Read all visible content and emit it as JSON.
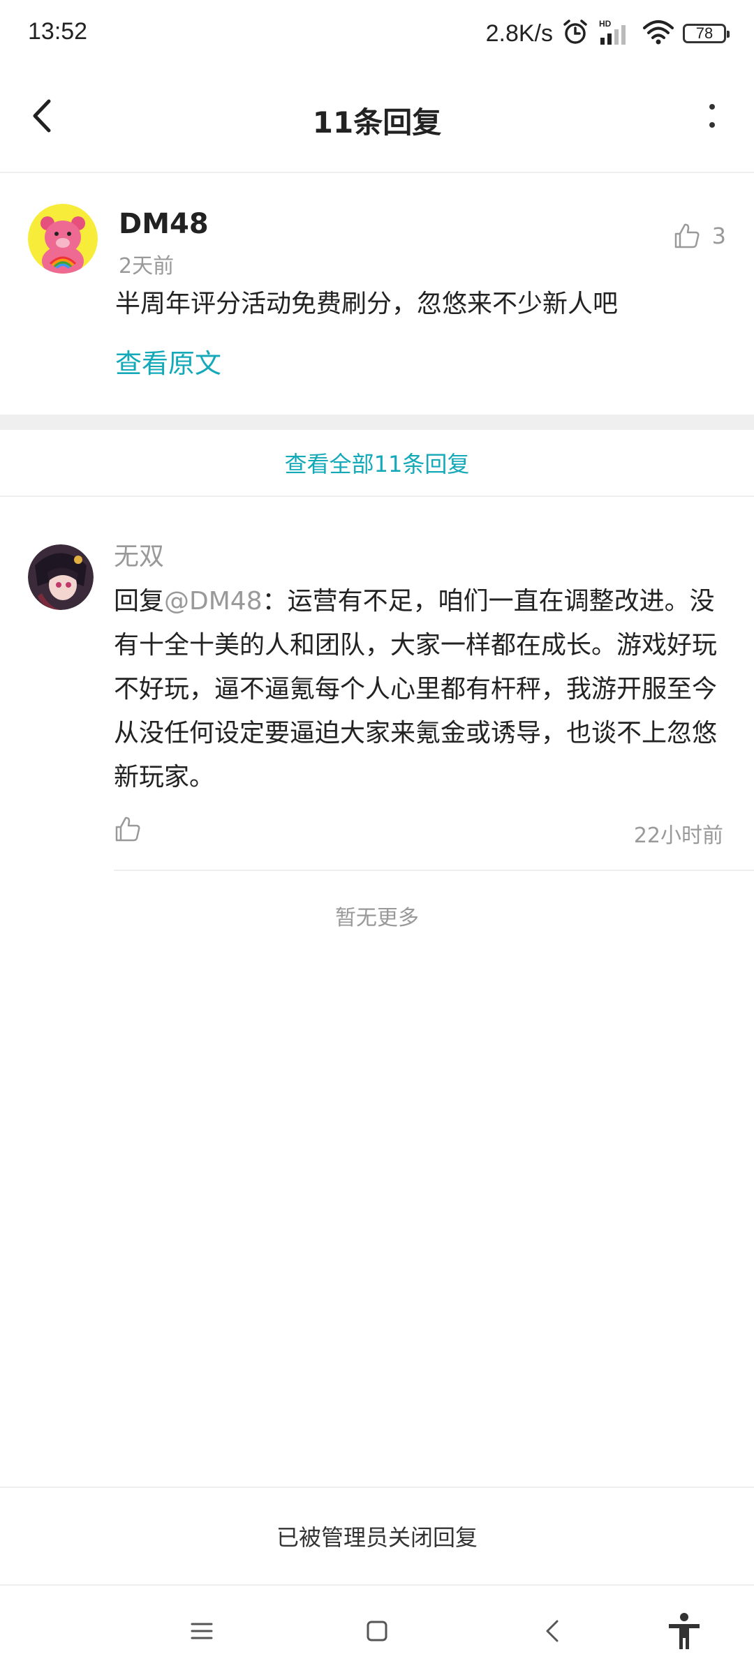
{
  "status_bar": {
    "time": "13:52",
    "net_speed": "2.8K/s",
    "battery": "78",
    "icons": [
      "alarm-icon",
      "hd-signal-icon",
      "wifi-icon",
      "battery-icon"
    ]
  },
  "header": {
    "title": "11条回复",
    "back_icon": "chevron-left-icon",
    "more_icon": "more-vertical-icon"
  },
  "main_comment": {
    "username": "DM48",
    "time": "2天前",
    "likes": "3",
    "content": "半周年评分活动免费刷分，忽悠来不少新人吧",
    "view_original": "查看原文"
  },
  "view_all": "查看全部11条回复",
  "reply": {
    "username": "无双",
    "prefix": "回复",
    "mention": "@DM48",
    "content": "：运营有不足，咱们一直在调整改进。没有十全十美的人和团队，大家一样都在成长。游戏好玩不好玩，逼不逼氪每个人心里都有杆秤，我游开服至今从没任何设定要逼迫大家来氪金或诱导，也谈不上忽悠新玩家。",
    "time": "22小时前"
  },
  "no_more": "暂无更多",
  "closed_notice": "已被管理员关闭回复",
  "colors": {
    "accent": "#14a9b8",
    "muted": "#999999",
    "text": "#222222",
    "divider": "#efefef"
  }
}
